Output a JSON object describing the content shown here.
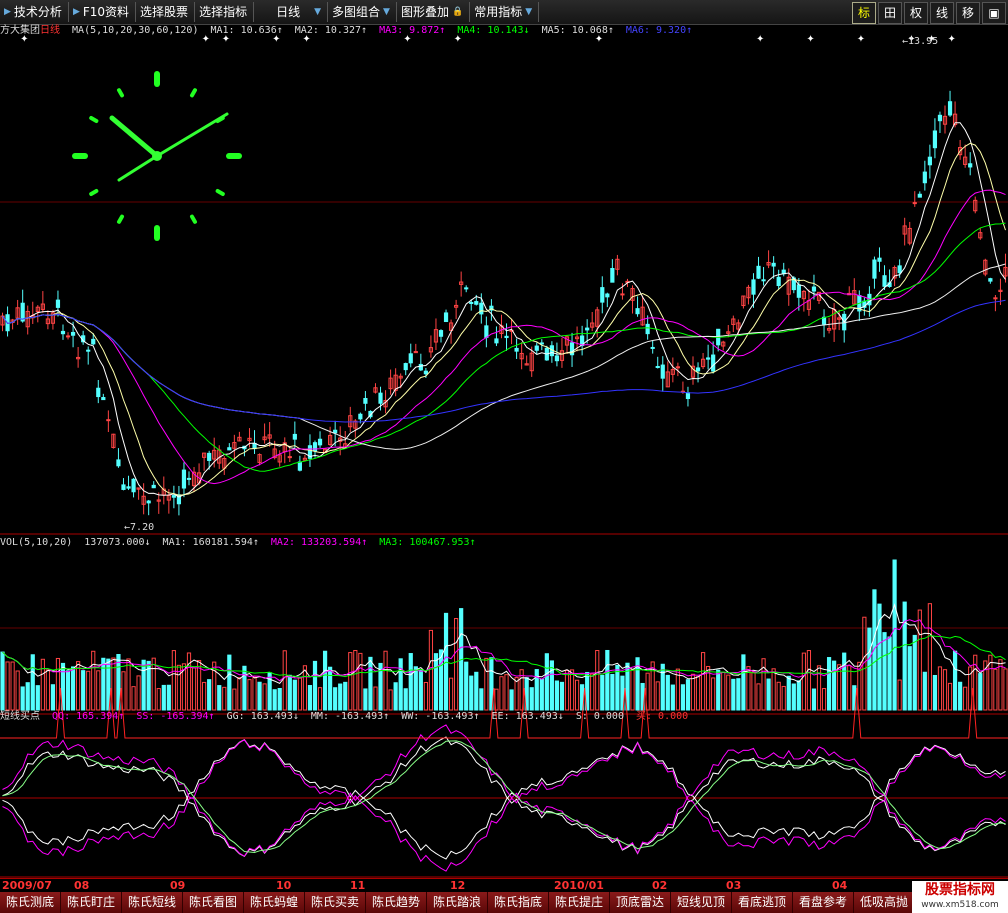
{
  "toolbar": {
    "buttons": [
      "技术分析",
      "F10资料",
      "选择股票",
      "选择指标",
      "日线",
      "多图组合",
      "图形叠加",
      "常用指标"
    ],
    "right": [
      "标",
      "田",
      "权",
      "线",
      "移",
      "▣"
    ]
  },
  "main_title": {
    "stock": "方大集团",
    "period": "日线",
    "ma_params": "MA(5,10,20,30,60,120)",
    "ma1": "MA1: 10.636↑",
    "ma2": "MA2: 10.327↑",
    "ma3": "MA3: 9.872↑",
    "ma4": "MA4: 10.143↓",
    "ma5": "MA5: 10.068↑",
    "ma6": "MA6: 9.320↑"
  },
  "price_labels": {
    "high": "13.95",
    "low": "7.20"
  },
  "vol_title": {
    "params": "VOL(5,10,20)",
    "vol": "137073.000↓",
    "ma1": "MA1: 160181.594↑",
    "ma2": "MA2: 133203.594↑",
    "ma3": "MA3: 100467.953↑"
  },
  "ind_title": {
    "name": "短线买点",
    "qq": "QQ: 165.394↑",
    "ss": "SS: -165.394↑",
    "gg": "GG: 163.493↓",
    "mm": "MM: -163.493↑",
    "ww": "WW: -163.493↑",
    "ee": "EE: 163.493↓",
    "s": "S: 0.000",
    "buy": "买: 0.000"
  },
  "dates": [
    "2009/07",
    "08",
    "09",
    "10",
    "11",
    "12",
    "2010/01",
    "02",
    "03",
    "04"
  ],
  "tabs": [
    "陈氏测底",
    "陈氏盯庄",
    "陈氏短线",
    "陈氏看图",
    "陈氏蚂蝗",
    "陈氏买卖",
    "陈氏趋势",
    "陈氏踏浪",
    "陈氏指底",
    "陈氏提庄",
    "顶底雷达",
    "短线见顶",
    "看底逃顶",
    "看盘参考",
    "低吸高抛"
  ],
  "watermark": {
    "text": "股票指标网",
    "url": "www.xm518.com"
  },
  "colors": {
    "up": "#ff4444",
    "down": "#54ffff",
    "ma1": "#ffffff",
    "ma2": "#ffff00",
    "ma3": "#ff00ff",
    "ma4": "#00ff00",
    "ma5": "#ffffff",
    "ma6": "#3333ff"
  }
}
